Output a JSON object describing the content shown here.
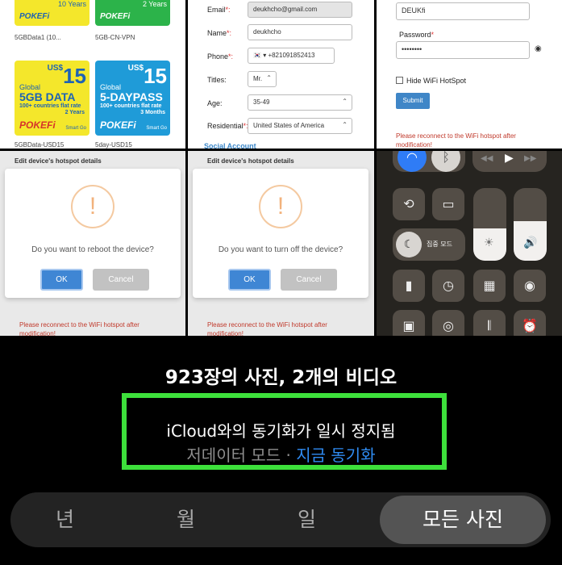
{
  "tile1": {
    "top_left_years": "10 Years",
    "top_right_years": "2 Years",
    "top_left_caption": "5GBData1 (10...",
    "top_right_caption": "5GB-CN-VPN",
    "card_left": {
      "currency": "US$",
      "price": "15",
      "tag": "Global",
      "big": "5GB DATA",
      "sub": "100+ countries flat rate",
      "term": "2 Years",
      "brand": "POKEFi",
      "smart": "Smart Go",
      "caption": "5GBData-USD15"
    },
    "card_right": {
      "currency": "US$",
      "price": "15",
      "tag": "Global",
      "big": "5-DAYPASS",
      "sub": "100+ countries flat rate",
      "term": "3 Months",
      "brand": "POKEFi",
      "smart": "Smart Go",
      "caption": "5day-USD15"
    },
    "top_brand": "POKEFi"
  },
  "tile2": {
    "email_label": "Email",
    "email_value": "deukhcho@gmail.com",
    "name_label": "Name",
    "name_value": "deukhcho",
    "phone_label": "Phone",
    "phone_value": "+821091852413",
    "titles_label": "Titles:",
    "titles_value": "Mr.",
    "age_label": "Age:",
    "age_value": "35-49",
    "residential_label": "Residential",
    "residential_value": "United States of America",
    "social_link": "Social Account",
    "req": "*:",
    "flag": "🇰🇷"
  },
  "tile3": {
    "ssid_value": "DEUKfi",
    "password_label": "Password",
    "password_value": "••••••••",
    "hide_label": "Hide WiFi HotSpot",
    "submit_label": "Submit",
    "reconnect_msg": "Please reconnect to the WiFi hotspot after modification!",
    "req": "*"
  },
  "dialog_reboot": {
    "header": "Edit device's hotspot details",
    "question": "Do you want to reboot the device?",
    "ok": "OK",
    "cancel": "Cancel",
    "reconnect_msg": "Please reconnect to the WiFi hotspot after modification!"
  },
  "dialog_off": {
    "header": "Edit device's hotspot details",
    "question": "Do you want to turn off the device?",
    "ok": "OK",
    "cancel": "Cancel",
    "reconnect_msg": "Please reconnect to the WiFi hotspot after modification!"
  },
  "control_center": {
    "focus_label": "집중 모드",
    "icons": [
      "wifi-icon",
      "bluetooth-icon",
      "rewind-icon",
      "play-icon",
      "fast-forward-icon",
      "rotation-lock-icon",
      "screen-mirroring-icon",
      "moon-icon",
      "flashlight-icon",
      "timer-icon",
      "calculator-icon",
      "camera-icon",
      "qr-scanner-icon",
      "record-icon",
      "sound-recognition-icon",
      "alarm-icon"
    ],
    "brightness_level": 0.45,
    "volume_level": 0.55
  },
  "library": {
    "count_text": "923장의 사진, 2개의 비디오",
    "sync_status": "iCloud와의 동기화가 일시 정지됨",
    "low_data_mode": "저데이터 모드 · ",
    "sync_now": "지금 동기화"
  },
  "segments": [
    "년",
    "월",
    "일",
    "모든 사진"
  ],
  "colors": {
    "highlight_box": "#3de03b",
    "link": "#2f8cf3",
    "active_segment": "#545454"
  }
}
